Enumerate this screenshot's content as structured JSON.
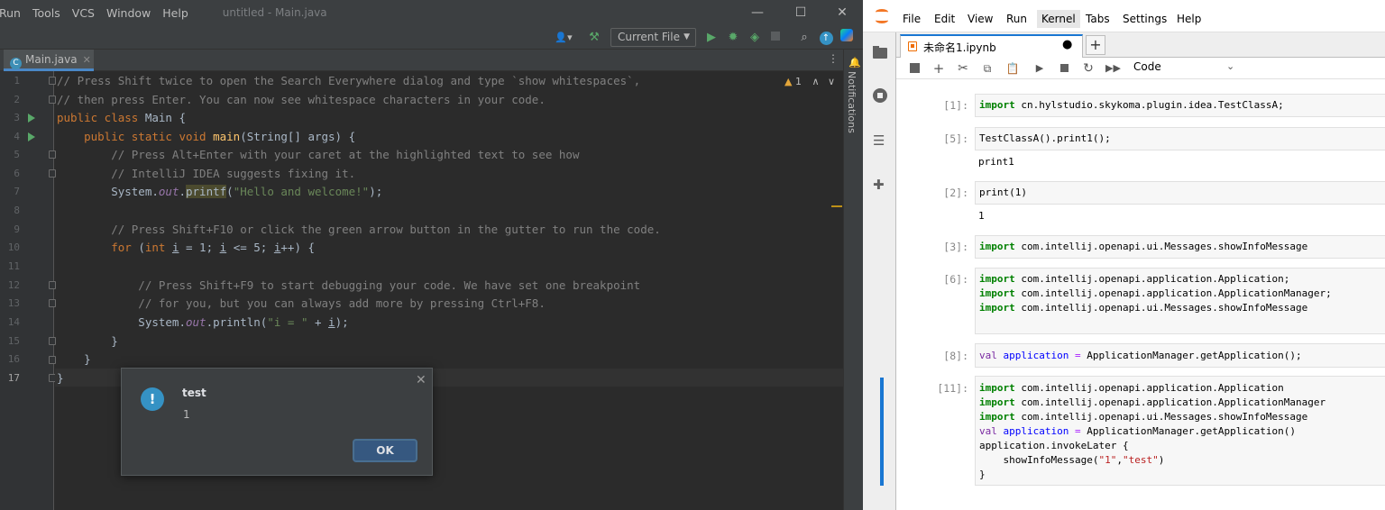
{
  "ide": {
    "menu": [
      "Run",
      "Tools",
      "VCS",
      "Window",
      "Help"
    ],
    "window_title": "untitled - Main.java",
    "window_controls": {
      "minimize": "—",
      "maximize": "☐",
      "close": "✕"
    },
    "run_config": "Current File",
    "tab": {
      "label": "Main.java"
    },
    "notifications_label": "Notifications",
    "warnings_count": "1",
    "line_numbers": [
      "1",
      "2",
      "3",
      "4",
      "5",
      "6",
      "7",
      "8",
      "9",
      "10",
      "11",
      "12",
      "13",
      "14",
      "15",
      "16",
      "17"
    ],
    "code": {
      "l1": "// Press Shift twice to open the Search Everywhere dialog and type `show whitespaces`,",
      "l2": "// then press Enter. You can now see whitespace characters in your code.",
      "l3_kw": "public class ",
      "l3_name": "Main {",
      "l4_kw": "    public static void ",
      "l4_fn": "main",
      "l4_rest": "(String[] args) {",
      "l5": "        // Press Alt+Enter with your caret at the highlighted text to see how",
      "l6": "        // IntelliJ IDEA suggests fixing it.",
      "l7_a": "        System.",
      "l7_out": "out",
      "l7_dot": ".",
      "l7_fn": "printf",
      "l7_paren": "(",
      "l7_str": "\"Hello and welcome!\"",
      "l7_end": ");",
      "l9": "        // Press Shift+F10 or click the green arrow button in the gutter to run the code.",
      "l10_kw1": "        for ",
      "l10_p": "(",
      "l10_kw2": "int ",
      "l10_i1": "i",
      "l10_a": " = 1; ",
      "l10_i2": "i",
      "l10_b": " <= 5; ",
      "l10_i3": "i",
      "l10_c": "++) {",
      "l12": "            // Press Shift+F9 to start debugging your code. We have set one breakpoint",
      "l13": "            // for you, but you can always add more by pressing Ctrl+F8.",
      "l14_a": "            System.",
      "l14_out": "out",
      "l14_b": ".println(",
      "l14_str": "\"i = \"",
      "l14_c": " + ",
      "l14_i": "i",
      "l14_d": ");",
      "l15": "        }",
      "l16": "    }",
      "l17": "}"
    },
    "dialog": {
      "title": "test",
      "message": "1",
      "ok_label": "OK",
      "icon": "!"
    }
  },
  "jupyter": {
    "menu": [
      "File",
      "Edit",
      "View",
      "Run",
      "Kernel",
      "Tabs",
      "Settings",
      "Help"
    ],
    "tab": {
      "label": "未命名1.ipynb",
      "dirty_indicator": "●"
    },
    "new_tab_label": "+",
    "cell_type": "Code",
    "cells": [
      {
        "prompt": "[1]:",
        "lines": [
          [
            "import",
            " cn.hylstudio.skykoma.plugin.idea.TestClassA;"
          ]
        ],
        "output": ""
      },
      {
        "prompt": "[5]:",
        "lines": [
          [
            "",
            "TestClassA().print1();"
          ]
        ],
        "output": "print1"
      },
      {
        "prompt": "[2]:",
        "lines": [
          [
            "",
            "print(1)"
          ]
        ],
        "output": "1"
      },
      {
        "prompt": "[3]:",
        "lines": [
          [
            "import",
            " com.intellij.openapi.ui.Messages.showInfoMessage"
          ]
        ],
        "output": ""
      },
      {
        "prompt": "[6]:",
        "lines": [
          [
            "import",
            " com.intellij.openapi.application.Application;"
          ],
          [
            "import",
            " com.intellij.openapi.application.ApplicationManager;"
          ],
          [
            "import",
            " com.intellij.openapi.ui.Messages.showInfoMessage"
          ]
        ],
        "output": ""
      },
      {
        "prompt": "[8]:",
        "output": ""
      },
      {
        "prompt": "[11]:",
        "output": ""
      }
    ],
    "cell8": {
      "kw": "val",
      "var": "application",
      "eq": " = ",
      "rest": "ApplicationManager.getApplication();"
    },
    "cell11": {
      "l1": [
        " com.intellij.openapi.application.Application"
      ],
      "l2": [
        " com.intellij.openapi.application.ApplicationManager"
      ],
      "l3": [
        " com.intellij.openapi.ui.Messages.showInfoMessage"
      ],
      "import_kw": "import",
      "l4_kw": "val",
      "l4_var": "application",
      "l4_eq": " = ",
      "l4_rest": "ApplicationManager.getApplication()",
      "l5": "application.invokeLater {",
      "l6_a": "    showInfoMessage(",
      "l6_s1": "\"1\"",
      "l6_comma": ",",
      "l6_s2": "\"test\"",
      "l6_end": ")",
      "l7": "}"
    }
  },
  "colors": {
    "ide_bg": "#2b2b2b",
    "accent": "#1976d2",
    "ok_button": "#365880",
    "run_green": "#59a869"
  }
}
